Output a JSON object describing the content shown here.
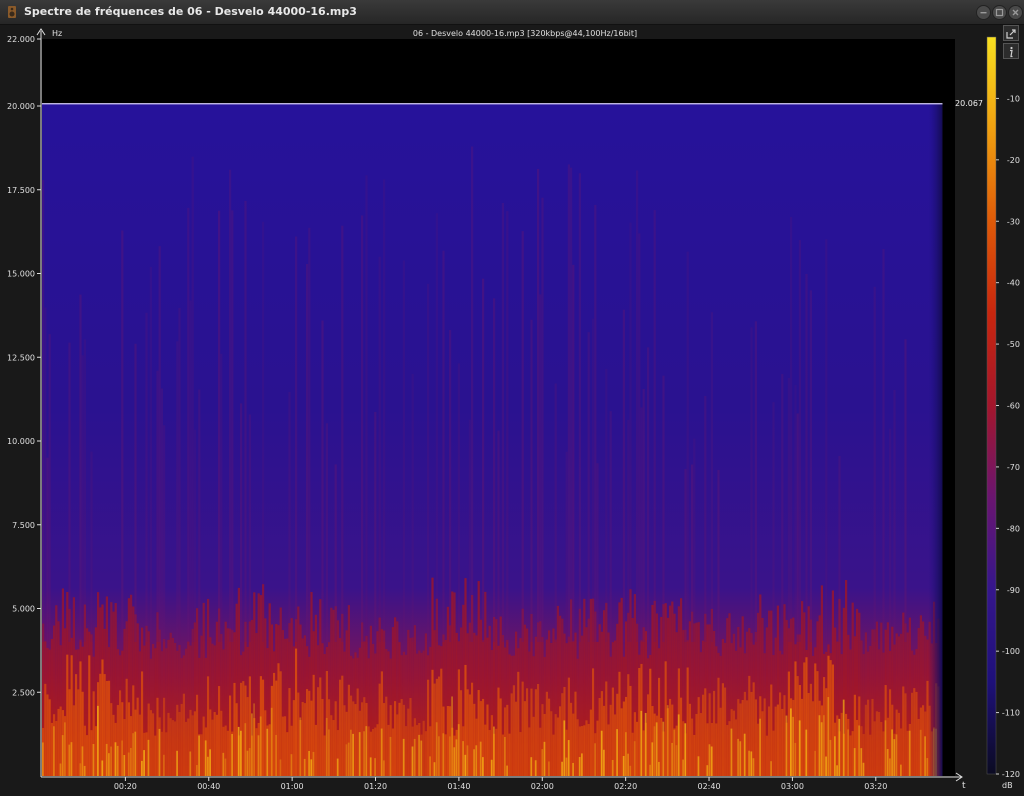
{
  "window": {
    "title": "Spectre de fréquences de 06 - Desvelo 44000-16.mp3",
    "icon": "speaker-app-icon",
    "controls": [
      "minimize-icon",
      "maximize-icon",
      "close-icon"
    ]
  },
  "toolbar": {
    "buttons": [
      "export-icon",
      "info-icon"
    ]
  },
  "chart_data": {
    "type": "heatmap",
    "title": "06 - Desvelo 44000-16.mp3 [320kbps@44,100Hz/16bit]",
    "ylabel": "Hz",
    "xlabel": "t",
    "ylim": [
      0,
      22000
    ],
    "y_ticks": [
      "22.000",
      "20.000",
      "17.500",
      "15.000",
      "12.500",
      "10.000",
      "7.500",
      "5.000",
      "2.500"
    ],
    "y_tick_values": [
      22000,
      20000,
      17500,
      15000,
      12500,
      10000,
      7500,
      5000,
      2500
    ],
    "x_ticks": [
      "00:20",
      "00:40",
      "01:00",
      "01:20",
      "01:40",
      "02:00",
      "02:20",
      "02:40",
      "03:00",
      "03:20"
    ],
    "x_tick_values": [
      20,
      40,
      60,
      80,
      100,
      120,
      140,
      160,
      180,
      200
    ],
    "xlim": [
      0,
      219
    ],
    "audio_end_seconds": 216,
    "cutoff_hz": 20067,
    "cutoff_label": "20.067",
    "colorbar": {
      "label": "dB",
      "ticks": [
        "-10",
        "-20",
        "-30",
        "-40",
        "-50",
        "-60",
        "-70",
        "-80",
        "-90",
        "-100",
        "-110",
        "-120"
      ],
      "tick_values": [
        -10,
        -20,
        -30,
        -40,
        -50,
        -60,
        -70,
        -80,
        -90,
        -100,
        -110,
        -120
      ],
      "range": [
        -120,
        0
      ],
      "colors": [
        "#0b0b22",
        "#1e107a",
        "#35168c",
        "#6a1570",
        "#a3162c",
        "#c8260e",
        "#df5a08",
        "#f0a010",
        "#f8e020"
      ]
    },
    "grid": false,
    "legend": "colorbar-right"
  }
}
